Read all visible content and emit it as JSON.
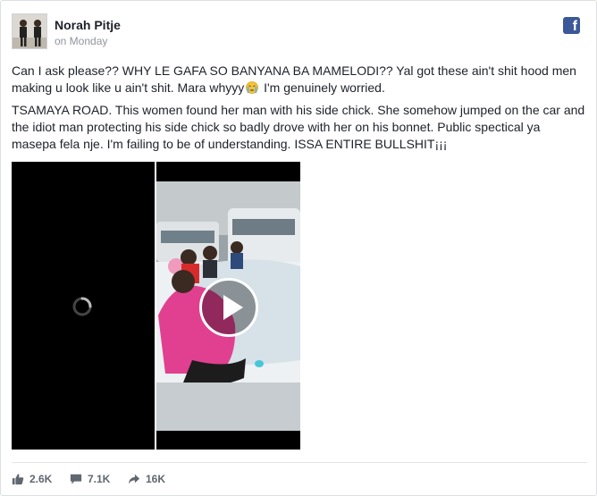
{
  "post": {
    "author": "Norah Pitje",
    "timestamp": "on Monday",
    "paragraph1": "Can I ask please?? WHY LE GAFA SO BANYANA BA MAMELODI?? Yal got these ain't shit hood men making u look like u ain't shit. Mara whyyy",
    "paragraph1_tail": " I'm genuinely worried.",
    "paragraph2": "TSAMAYA ROAD. This women found her man with his side chick. She somehow jumped on the car and the idiot man protecting his side chick so badly drove with her on his bonnet. Public spectical ya masepa fela nje. I'm failing to be of understanding. ISSA ENTIRE BULLSHIT¡¡¡",
    "emoji": "crying-face-icon"
  },
  "brand": {
    "logo_letter": "f",
    "color": "#3b5998"
  },
  "stats": {
    "likes": "2.6K",
    "comments": "7.1K",
    "shares": "16K"
  },
  "icons": {
    "like": "thumbs-up-icon",
    "comment": "speech-bubble-icon",
    "share": "share-arrow-icon",
    "play": "play-icon",
    "spinner": "loading-spinner-icon"
  }
}
